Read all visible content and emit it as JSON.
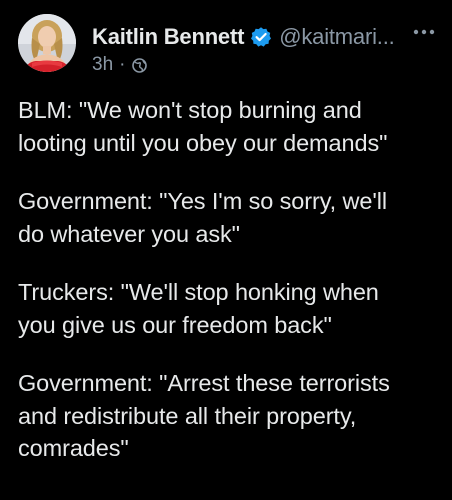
{
  "author": {
    "display_name": "Kaitlin Bennett",
    "handle": "@kaitmari...",
    "verified_icon": "verified-badge-icon",
    "avatar_icon": "profile-photo"
  },
  "meta": {
    "time": "3h",
    "separator": "·",
    "visibility_icon": "globe-icon"
  },
  "more_icon": "more-options-icon",
  "paragraphs": [
    "BLM: \"We won't stop burning and\nlooting until you obey our demands\"",
    "Government: \"Yes I'm so sorry, we'll\ndo whatever you ask\"",
    "Truckers: \"We'll stop honking when\nyou give us our freedom back\"",
    "Government: \"Arrest these terrorists\nand redistribute all their property,\ncomrades\""
  ],
  "colors": {
    "background": "#000000",
    "text": "#e7e9ea",
    "secondary": "#8b98a5",
    "verified": "#1d9bf0"
  }
}
